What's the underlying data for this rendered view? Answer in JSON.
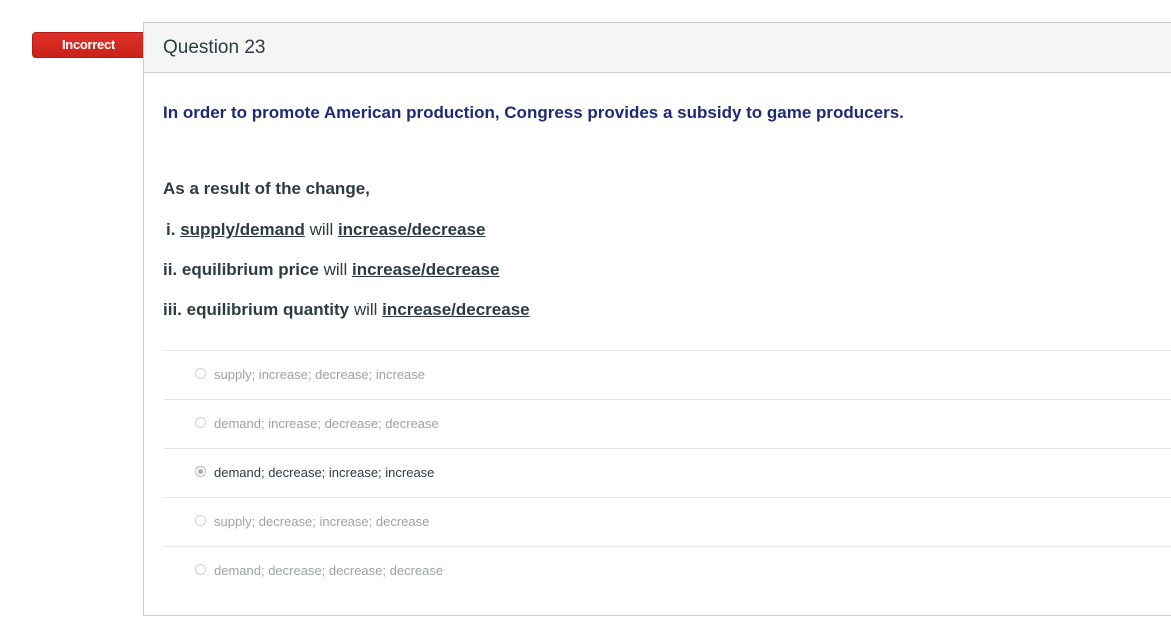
{
  "status_badge": "Incorrect",
  "question": {
    "title": "Question 23",
    "prompt": "In order to promote American production, Congress provides a subsidy to game producers.",
    "result_intro": "As a result of the change,",
    "lines": [
      {
        "prefix": "i.",
        "subject": "supply/demand",
        "will": "will",
        "choice": "increase/decrease"
      },
      {
        "prefix": "ii.",
        "subject": "equilibrium price",
        "will": "will",
        "choice": "increase/decrease"
      },
      {
        "prefix": "iii.",
        "subject": "equilibrium quantity",
        "will": "will",
        "choice": "increase/decrease"
      }
    ]
  },
  "answers": [
    {
      "label": "supply; increase; decrease; increase",
      "selected": false
    },
    {
      "label": "demand; increase; decrease; decrease",
      "selected": false
    },
    {
      "label": "demand; decrease; increase; increase",
      "selected": true
    },
    {
      "label": "supply; decrease; increase; decrease",
      "selected": false
    },
    {
      "label": "demand; decrease; decrease; decrease",
      "selected": false
    }
  ],
  "colors": {
    "badge": "#d8281f",
    "prompt_text": "#1e2a78",
    "border": "#c7cdd1"
  }
}
